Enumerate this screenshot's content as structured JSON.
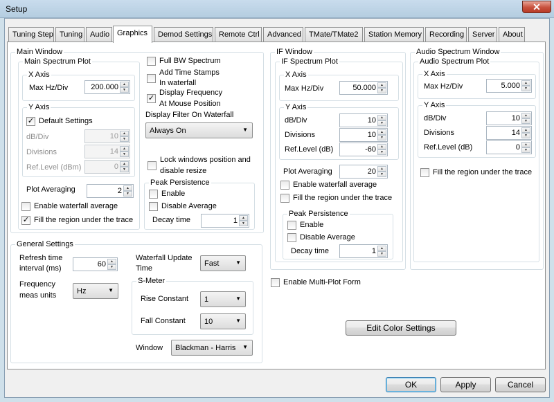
{
  "window": {
    "title": "Setup",
    "close_glyph": "✕"
  },
  "tabs": [
    "Tuning Step",
    "Tuning",
    "Audio",
    "Graphics",
    "Demod Settings",
    "Remote Ctrl",
    "Advanced",
    "TMate/TMate2",
    "Station Memory",
    "Recording",
    "Server",
    "About"
  ],
  "active_tab": "Graphics",
  "main_window": {
    "title": "Main Window",
    "spectrum_plot": {
      "title": "Main Spectrum Plot",
      "x_axis": {
        "title": "X Axis",
        "max_hz_div_label": "Max Hz/Div",
        "max_hz_div_value": "200.000"
      },
      "y_axis": {
        "title": "Y Axis",
        "default_settings_label": "Default Settings",
        "default_settings_checked": true,
        "db_div_label": "dB/Div",
        "db_div_value": "10",
        "divisions_label": "Divisions",
        "divisions_value": "14",
        "ref_level_label": "Ref.Level (dBm)",
        "ref_level_value": "0"
      },
      "plot_averaging_label": "Plot Averaging",
      "plot_averaging_value": "2",
      "waterfall_avg_label": "Enable waterfall average",
      "waterfall_avg_checked": false,
      "fill_region_label": "Fill the region under the trace",
      "fill_region_checked": true
    },
    "full_bw_label": "Full BW Spectrum",
    "full_bw_checked": false,
    "timestamps_label_1": "Add Time Stamps",
    "timestamps_label_2": "In waterfall",
    "timestamps_checked": false,
    "display_freq_label_1": "Display Frequency",
    "display_freq_label_2": "At Mouse Position",
    "display_freq_checked": true,
    "display_filter_label": "Display Filter On Waterfall",
    "display_filter_value": "Always On",
    "lock_windows_label_1": "Lock windows position and",
    "lock_windows_label_2": "disable resize",
    "lock_windows_checked": false,
    "peak_persistence": {
      "title": "Peak Persistence",
      "enable_label": "Enable",
      "enable_checked": false,
      "disable_avg_label": "Disable Average",
      "disable_avg_checked": false,
      "decay_label": "Decay time",
      "decay_value": "1"
    }
  },
  "general": {
    "title": "General Settings",
    "refresh_label_1": "Refresh time",
    "refresh_label_2": "interval (ms)",
    "refresh_value": "60",
    "freq_meas_label_1": "Frequency",
    "freq_meas_label_2": "meas units",
    "freq_meas_value": "Hz",
    "waterfall_update_label_1": "Waterfall Update",
    "waterfall_update_label_2": "Time",
    "waterfall_update_value": "Fast",
    "smeter": {
      "title": "S-Meter",
      "rise_label": "Rise Constant",
      "rise_value": "1",
      "fall_label": "Fall Constant",
      "fall_value": "10"
    },
    "window_label": "Window",
    "window_value": "Blackman - Harris"
  },
  "if_window": {
    "title": "IF Window",
    "plot_title": "IF Spectrum Plot",
    "x_axis": {
      "title": "X Axis",
      "max_hz_div_label": "Max Hz/Div",
      "max_hz_div_value": "50.000"
    },
    "y_axis": {
      "title": "Y Axis",
      "db_div_label": "dB/Div",
      "db_div_value": "10",
      "divisions_label": "Divisions",
      "divisions_value": "10",
      "ref_level_label": "Ref.Level (dB)",
      "ref_level_value": "-60"
    },
    "plot_averaging_label": "Plot Averaging",
    "plot_averaging_value": "20",
    "waterfall_avg_label": "Enable waterfall average",
    "waterfall_avg_checked": false,
    "fill_region_label": "Fill the region under the trace",
    "fill_region_checked": false,
    "peak_persistence": {
      "title": "Peak Persistence",
      "enable_label": "Enable",
      "enable_checked": false,
      "disable_avg_label": "Disable Average",
      "disable_avg_checked": false,
      "decay_label": "Decay time",
      "decay_value": "1"
    }
  },
  "audio_window": {
    "title": "Audio Spectrum Window",
    "plot_title": "Audio Spectrum Plot",
    "x_axis": {
      "title": "X Axis",
      "max_hz_div_label": "Max Hz/Div",
      "max_hz_div_value": "5.000"
    },
    "y_axis": {
      "title": "Y Axis",
      "db_div_label": "dB/Div",
      "db_div_value": "10",
      "divisions_label": "Divisions",
      "divisions_value": "14",
      "ref_level_label": "Ref.Level (dB)",
      "ref_level_value": "0"
    },
    "fill_region_label": "Fill the region under the trace",
    "fill_region_checked": false
  },
  "multi_plot_label": "Enable Multi-Plot Form",
  "multi_plot_checked": false,
  "edit_color_label": "Edit Color Settings",
  "buttons": {
    "ok": "OK",
    "apply": "Apply",
    "cancel": "Cancel"
  },
  "glyphs": {
    "check": "✓",
    "spin_up": "▲",
    "spin_down": "▼",
    "combo_arrow": "▼"
  }
}
